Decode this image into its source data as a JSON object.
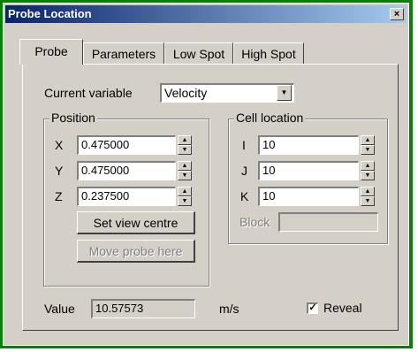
{
  "window": {
    "title": "Probe Location",
    "close_glyph": "×"
  },
  "tabs": [
    {
      "label": "Probe",
      "active": true
    },
    {
      "label": "Parameters",
      "active": false
    },
    {
      "label": "Low Spot",
      "active": false
    },
    {
      "label": "High Spot",
      "active": false
    }
  ],
  "probe": {
    "current_variable_label": "Current variable",
    "current_variable_value": "Velocity",
    "position": {
      "title": "Position",
      "x_label": "X",
      "x_value": "0.475000",
      "y_label": "Y",
      "y_value": "0.475000",
      "z_label": "Z",
      "z_value": "0.237500",
      "set_view_centre_label": "Set view centre",
      "move_probe_here_label": "Move probe here"
    },
    "cell_location": {
      "title": "Cell location",
      "i_label": "I",
      "i_value": "10",
      "j_label": "J",
      "j_value": "10",
      "k_label": "K",
      "k_value": "10",
      "block_label": "Block",
      "block_value": ""
    },
    "value_label": "Value",
    "value": "10.57573",
    "unit": "m/s",
    "reveal_label": "Reveal",
    "reveal_checked": true,
    "check_glyph": "✓"
  },
  "icons": {
    "spin_up": "▲",
    "spin_down": "▼",
    "dropdown": "▼"
  }
}
